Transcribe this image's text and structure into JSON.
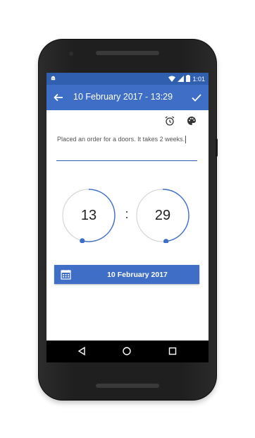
{
  "status_bar": {
    "time": "1:01",
    "icons": [
      "android-notification-icon",
      "wifi-icon",
      "signal-icon",
      "battery-icon"
    ]
  },
  "app_bar": {
    "title": "10 February 2017 - 13:29",
    "back_icon": "arrow-back-icon",
    "confirm_icon": "check-icon"
  },
  "toolbar": {
    "icons": [
      "alarm-icon",
      "palette-icon"
    ]
  },
  "note": {
    "text": "Placed an order for a doors. It takes 2 weeks."
  },
  "time_picker": {
    "hour": "13",
    "separator": ":",
    "minute": "29",
    "hour_fraction": 0.54,
    "minute_fraction": 0.48
  },
  "date_button": {
    "label": "10 February 2017",
    "icon": "calendar-icon"
  },
  "nav_bar": {
    "icons": [
      "nav-back-icon",
      "nav-home-icon",
      "nav-recents-icon"
    ]
  },
  "colors": {
    "primary": "#3f6ec6",
    "primary_dark": "#2f5fae",
    "accent": "#3f6ec6",
    "ring": "#d6d6d6"
  }
}
